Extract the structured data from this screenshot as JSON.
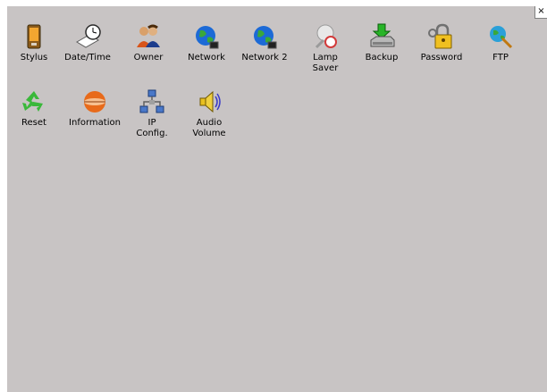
{
  "window": {
    "close_glyph": "×"
  },
  "items": [
    {
      "label": "Stylus",
      "icon": "stylus-icon"
    },
    {
      "label": "Date/Time",
      "icon": "clock-icon"
    },
    {
      "label": "Owner",
      "icon": "owner-icon"
    },
    {
      "label": "Network",
      "icon": "network-globe-icon"
    },
    {
      "label": "Network 2",
      "icon": "network-globe-icon"
    },
    {
      "label": "Lamp\nSaver",
      "icon": "lamp-saver-icon"
    },
    {
      "label": "Backup",
      "icon": "backup-drive-icon"
    },
    {
      "label": "Password",
      "icon": "password-lock-icon"
    },
    {
      "label": "FTP",
      "icon": "ftp-icon"
    },
    {
      "label": "Reset",
      "icon": "recycle-icon"
    },
    {
      "label": "Information",
      "icon": "information-icon"
    },
    {
      "label": "IP\nConfig.",
      "icon": "ip-config-icon"
    },
    {
      "label": "Audio\nVolume",
      "icon": "speaker-icon"
    }
  ]
}
